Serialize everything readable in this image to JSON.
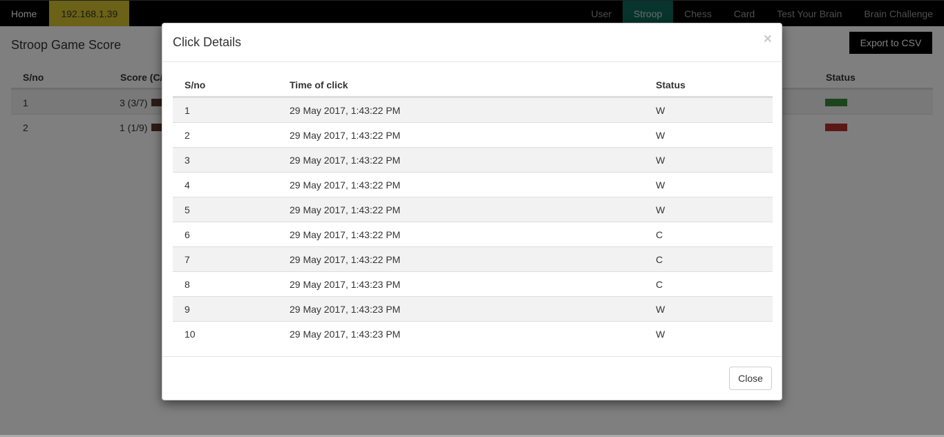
{
  "navbar": {
    "home_label": "Home",
    "ip_label": "192.168.1.39",
    "items": [
      "User",
      "Stroop",
      "Chess",
      "Card",
      "Test Your Brain",
      "Brain Challenge"
    ],
    "active_item": "Stroop"
  },
  "page": {
    "title": "Stroop Game Score",
    "export_label": "Export to CSV",
    "table": {
      "headers": {
        "sno": "S/no",
        "score": "Score (C/",
        "status": "Status"
      },
      "rows": [
        {
          "sno": "1",
          "score": "3 (3/7)",
          "status_color": "#3a8a3a"
        },
        {
          "sno": "2",
          "score": "1 (1/9)",
          "status_color": "#b8312a"
        }
      ]
    }
  },
  "modal": {
    "title": "Click Details",
    "close_x": "×",
    "headers": {
      "sno": "S/no",
      "time": "Time of click",
      "status": "Status"
    },
    "rows": [
      {
        "sno": "1",
        "time": "29 May 2017, 1:43:22 PM",
        "status": "W"
      },
      {
        "sno": "2",
        "time": "29 May 2017, 1:43:22 PM",
        "status": "W"
      },
      {
        "sno": "3",
        "time": "29 May 2017, 1:43:22 PM",
        "status": "W"
      },
      {
        "sno": "4",
        "time": "29 May 2017, 1:43:22 PM",
        "status": "W"
      },
      {
        "sno": "5",
        "time": "29 May 2017, 1:43:22 PM",
        "status": "W"
      },
      {
        "sno": "6",
        "time": "29 May 2017, 1:43:22 PM",
        "status": "C"
      },
      {
        "sno": "7",
        "time": "29 May 2017, 1:43:22 PM",
        "status": "C"
      },
      {
        "sno": "8",
        "time": "29 May 2017, 1:43:23 PM",
        "status": "C"
      },
      {
        "sno": "9",
        "time": "29 May 2017, 1:43:23 PM",
        "status": "W"
      },
      {
        "sno": "10",
        "time": "29 May 2017, 1:43:23 PM",
        "status": "W"
      }
    ],
    "close_label": "Close"
  }
}
